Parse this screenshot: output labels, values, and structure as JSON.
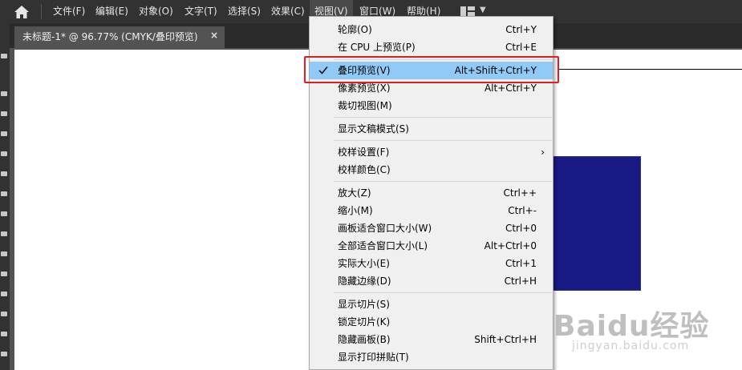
{
  "menubar": {
    "items": [
      "文件(F)",
      "编辑(E)",
      "对象(O)",
      "文字(T)",
      "选择(S)",
      "效果(C)",
      "视图(V)",
      "窗口(W)",
      "帮助(H)"
    ]
  },
  "document": {
    "tab_title": "未标题-1* @ 96.77% (CMYK/叠印预览)",
    "close_glyph": "×"
  },
  "view_menu": {
    "items": [
      {
        "label": "轮廓(O)",
        "shortcut": "Ctrl+Y"
      },
      {
        "label": "在 CPU 上预览(P)",
        "shortcut": "Ctrl+E"
      },
      {
        "label": "叠印预览(V)",
        "shortcut": "Alt+Shift+Ctrl+Y"
      },
      {
        "label": "像素预览(X)",
        "shortcut": "Alt+Ctrl+Y"
      },
      {
        "label": "裁切视图(M)",
        "shortcut": ""
      },
      {
        "label": "显示文稿模式(S)",
        "shortcut": ""
      },
      {
        "label": "校样设置(F)",
        "shortcut": "",
        "submenu": "›"
      },
      {
        "label": "校样颜色(C)",
        "shortcut": ""
      },
      {
        "label": "放大(Z)",
        "shortcut": "Ctrl++"
      },
      {
        "label": "缩小(M)",
        "shortcut": "Ctrl+-"
      },
      {
        "label": "画板适合窗口大小(W)",
        "shortcut": "Ctrl+0"
      },
      {
        "label": "全部适合窗口大小(L)",
        "shortcut": "Alt+Ctrl+0"
      },
      {
        "label": "实际大小(E)",
        "shortcut": "Ctrl+1"
      },
      {
        "label": "隐藏边缘(D)",
        "shortcut": "Ctrl+H"
      },
      {
        "label": "显示切片(S)",
        "shortcut": ""
      },
      {
        "label": "锁定切片(K)",
        "shortcut": ""
      },
      {
        "label": "隐藏画板(B)",
        "shortcut": "Shift+Ctrl+H"
      },
      {
        "label": "显示打印拼贴(T)",
        "shortcut": ""
      }
    ],
    "checked_item": "叠印预览(V)"
  },
  "watermark": {
    "logo_text": "Baidu经验",
    "url_text": "jingyan.baidu.com"
  },
  "colors": {
    "highlight": "#91c9f7",
    "annotation_box": "#e02020",
    "artwork_fill": "#1a1a85"
  }
}
